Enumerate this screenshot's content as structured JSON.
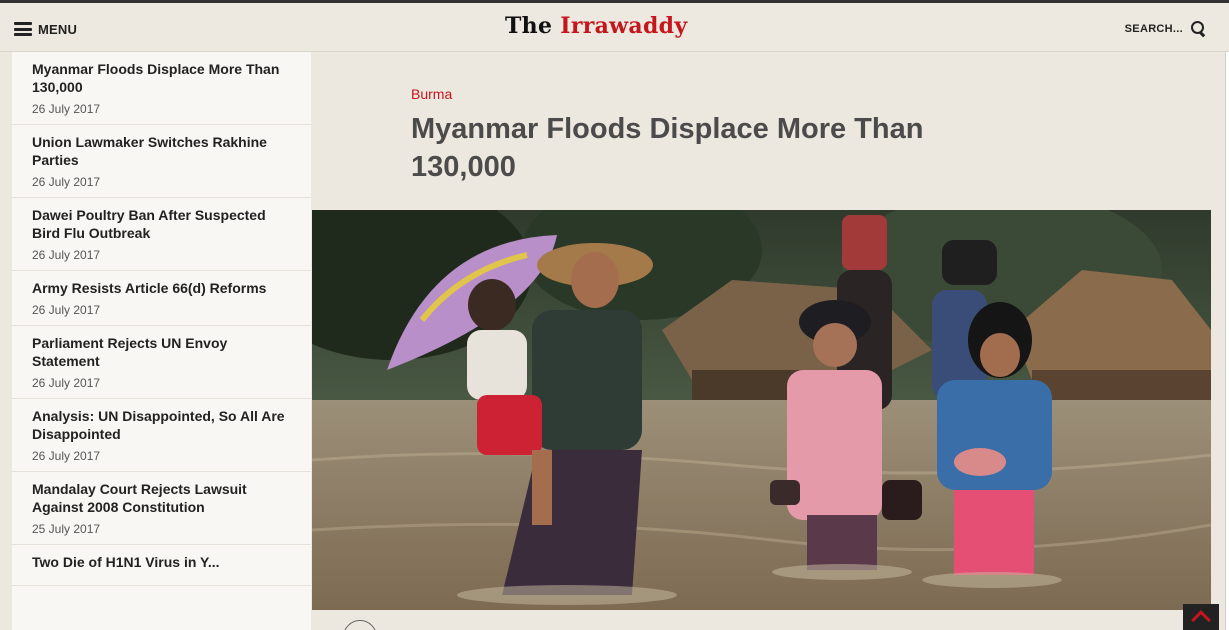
{
  "header": {
    "menu_label": "MENU",
    "logo_the": "The",
    "logo_name": "Irrawaddy",
    "search_label": "SEARCH..."
  },
  "sidebar": {
    "items": [
      {
        "title": "Myanmar Floods Displace More Than 130,000",
        "date": "26 July 2017"
      },
      {
        "title": "Union Lawmaker Switches Rakhine Parties",
        "date": "26 July 2017"
      },
      {
        "title": "Dawei Poultry Ban After Suspected Bird Flu Outbreak",
        "date": "26 July 2017"
      },
      {
        "title": "Army Resists Article 66(d) Reforms",
        "date": "26 July 2017"
      },
      {
        "title": "Parliament Rejects UN Envoy Statement",
        "date": "26 July 2017"
      },
      {
        "title": "Analysis: UN Disappointed, So All Are Disappointed",
        "date": "26 July 2017"
      },
      {
        "title": "Mandalay Court Rejects Lawsuit Against 2008 Constitution",
        "date": "25 July 2017"
      },
      {
        "title": "Two Die of H1N1 Virus in Y...",
        "date": ""
      }
    ]
  },
  "article": {
    "category": "Burma",
    "headline": "Myanmar Floods Displace More Than 130,000"
  },
  "colors": {
    "accent": "#c4161c",
    "background": "#ece8df",
    "sidebar": "#f8f7f3",
    "headline": "#4b4b4b"
  }
}
